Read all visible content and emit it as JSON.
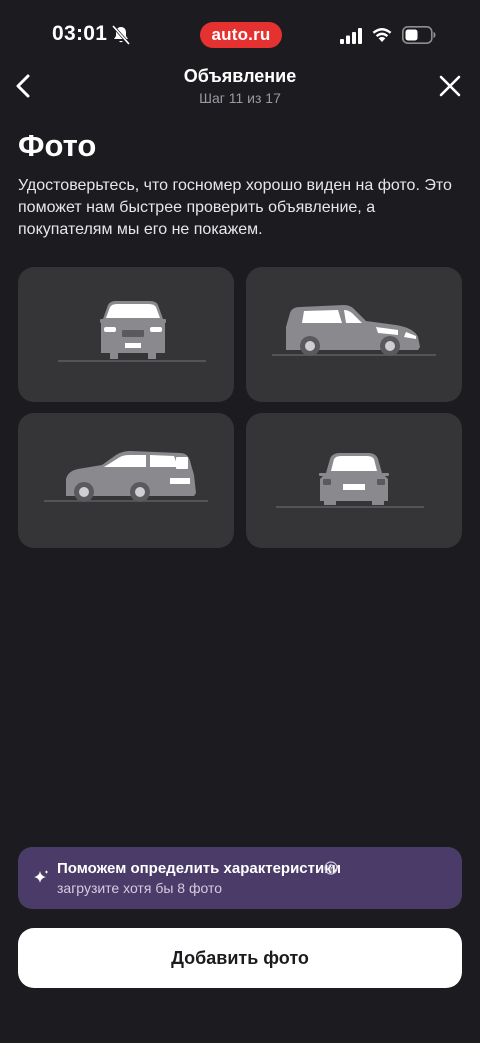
{
  "status_bar": {
    "time": "03:01",
    "brand": "auto.ru",
    "icons": [
      "bell-muted-icon",
      "signal-icon",
      "wifi-icon",
      "battery-icon"
    ]
  },
  "header": {
    "title": "Объявление",
    "step": "Шаг 11 из 17",
    "back_icon": "chevron-left-icon",
    "close_icon": "close-icon"
  },
  "page": {
    "title": "Фото",
    "description": "Удостоверьтесь, что госномер хорошо виден на фото. Это поможет нам быстрее проверить объявление, а покупателям мы его не покажем."
  },
  "photo_examples": [
    {
      "view": "front",
      "icon": "car-front-icon"
    },
    {
      "view": "front-side",
      "icon": "car-front-side-icon"
    },
    {
      "view": "rear-side",
      "icon": "car-rear-side-icon"
    },
    {
      "view": "rear",
      "icon": "car-rear-icon"
    }
  ],
  "hint": {
    "title": "Поможем определить характеристики",
    "subtitle": "загрузите хотя бы 8 фото",
    "icon": "sparkle-icon",
    "help_icon": "question-circle-icon"
  },
  "actions": {
    "add_photo_label": "Добавить фото"
  },
  "colors": {
    "background": "#1c1b1f",
    "card": "#353538",
    "brand": "#e5312f",
    "hint_background": "#4b3b68",
    "button": "#ffffff"
  }
}
